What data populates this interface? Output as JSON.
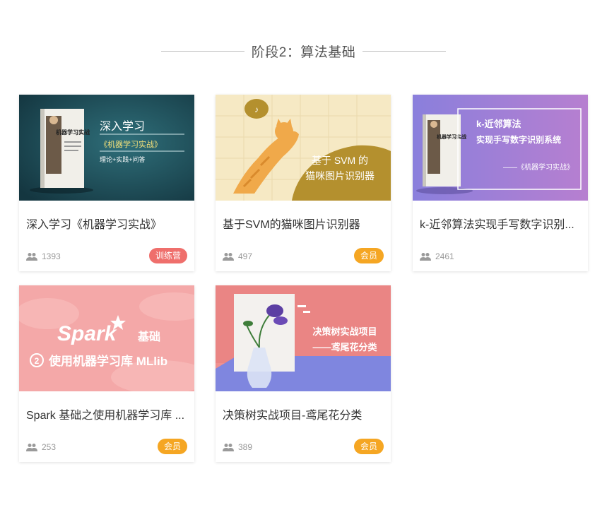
{
  "section": {
    "title": "阶段2：算法基础"
  },
  "colors": {
    "badge_member": "#f5a623",
    "badge_camp": "#ef6f6c"
  },
  "courses": [
    {
      "title": "深入学习《机器学习实战》",
      "students": "1393",
      "badge": "训练营",
      "thumb": {
        "heading": "深入学习",
        "subtitle": "《机器学习实战》",
        "tagline": "理论+实践+问答",
        "book_title": "机器学习实战"
      }
    },
    {
      "title": "基于SVM的猫咪图片识别器",
      "students": "497",
      "badge": "会员",
      "thumb": {
        "line1": "基于 SVM 的",
        "line2": "猫咪图片识别器"
      }
    },
    {
      "title": "k-近邻算法实现手写数字识别...",
      "students": "2461",
      "badge": "",
      "thumb": {
        "line1": "k-近邻算法",
        "line2": "实现手写数字识别系统",
        "line3": "——《机器学习实战》",
        "book_title": "机器学习实战"
      }
    },
    {
      "title": "Spark 基础之使用机器学习库 ...",
      "students": "253",
      "badge": "会员",
      "thumb": {
        "brand": "Spark",
        "suffix": "基础",
        "number": "2",
        "line2": "使用机器学习库 MLlib"
      }
    },
    {
      "title": "决策树实战项目-鸢尾花分类",
      "students": "389",
      "badge": "会员",
      "thumb": {
        "line1": "决策树实战项目",
        "line2": "——鸢尾花分类"
      }
    }
  ]
}
